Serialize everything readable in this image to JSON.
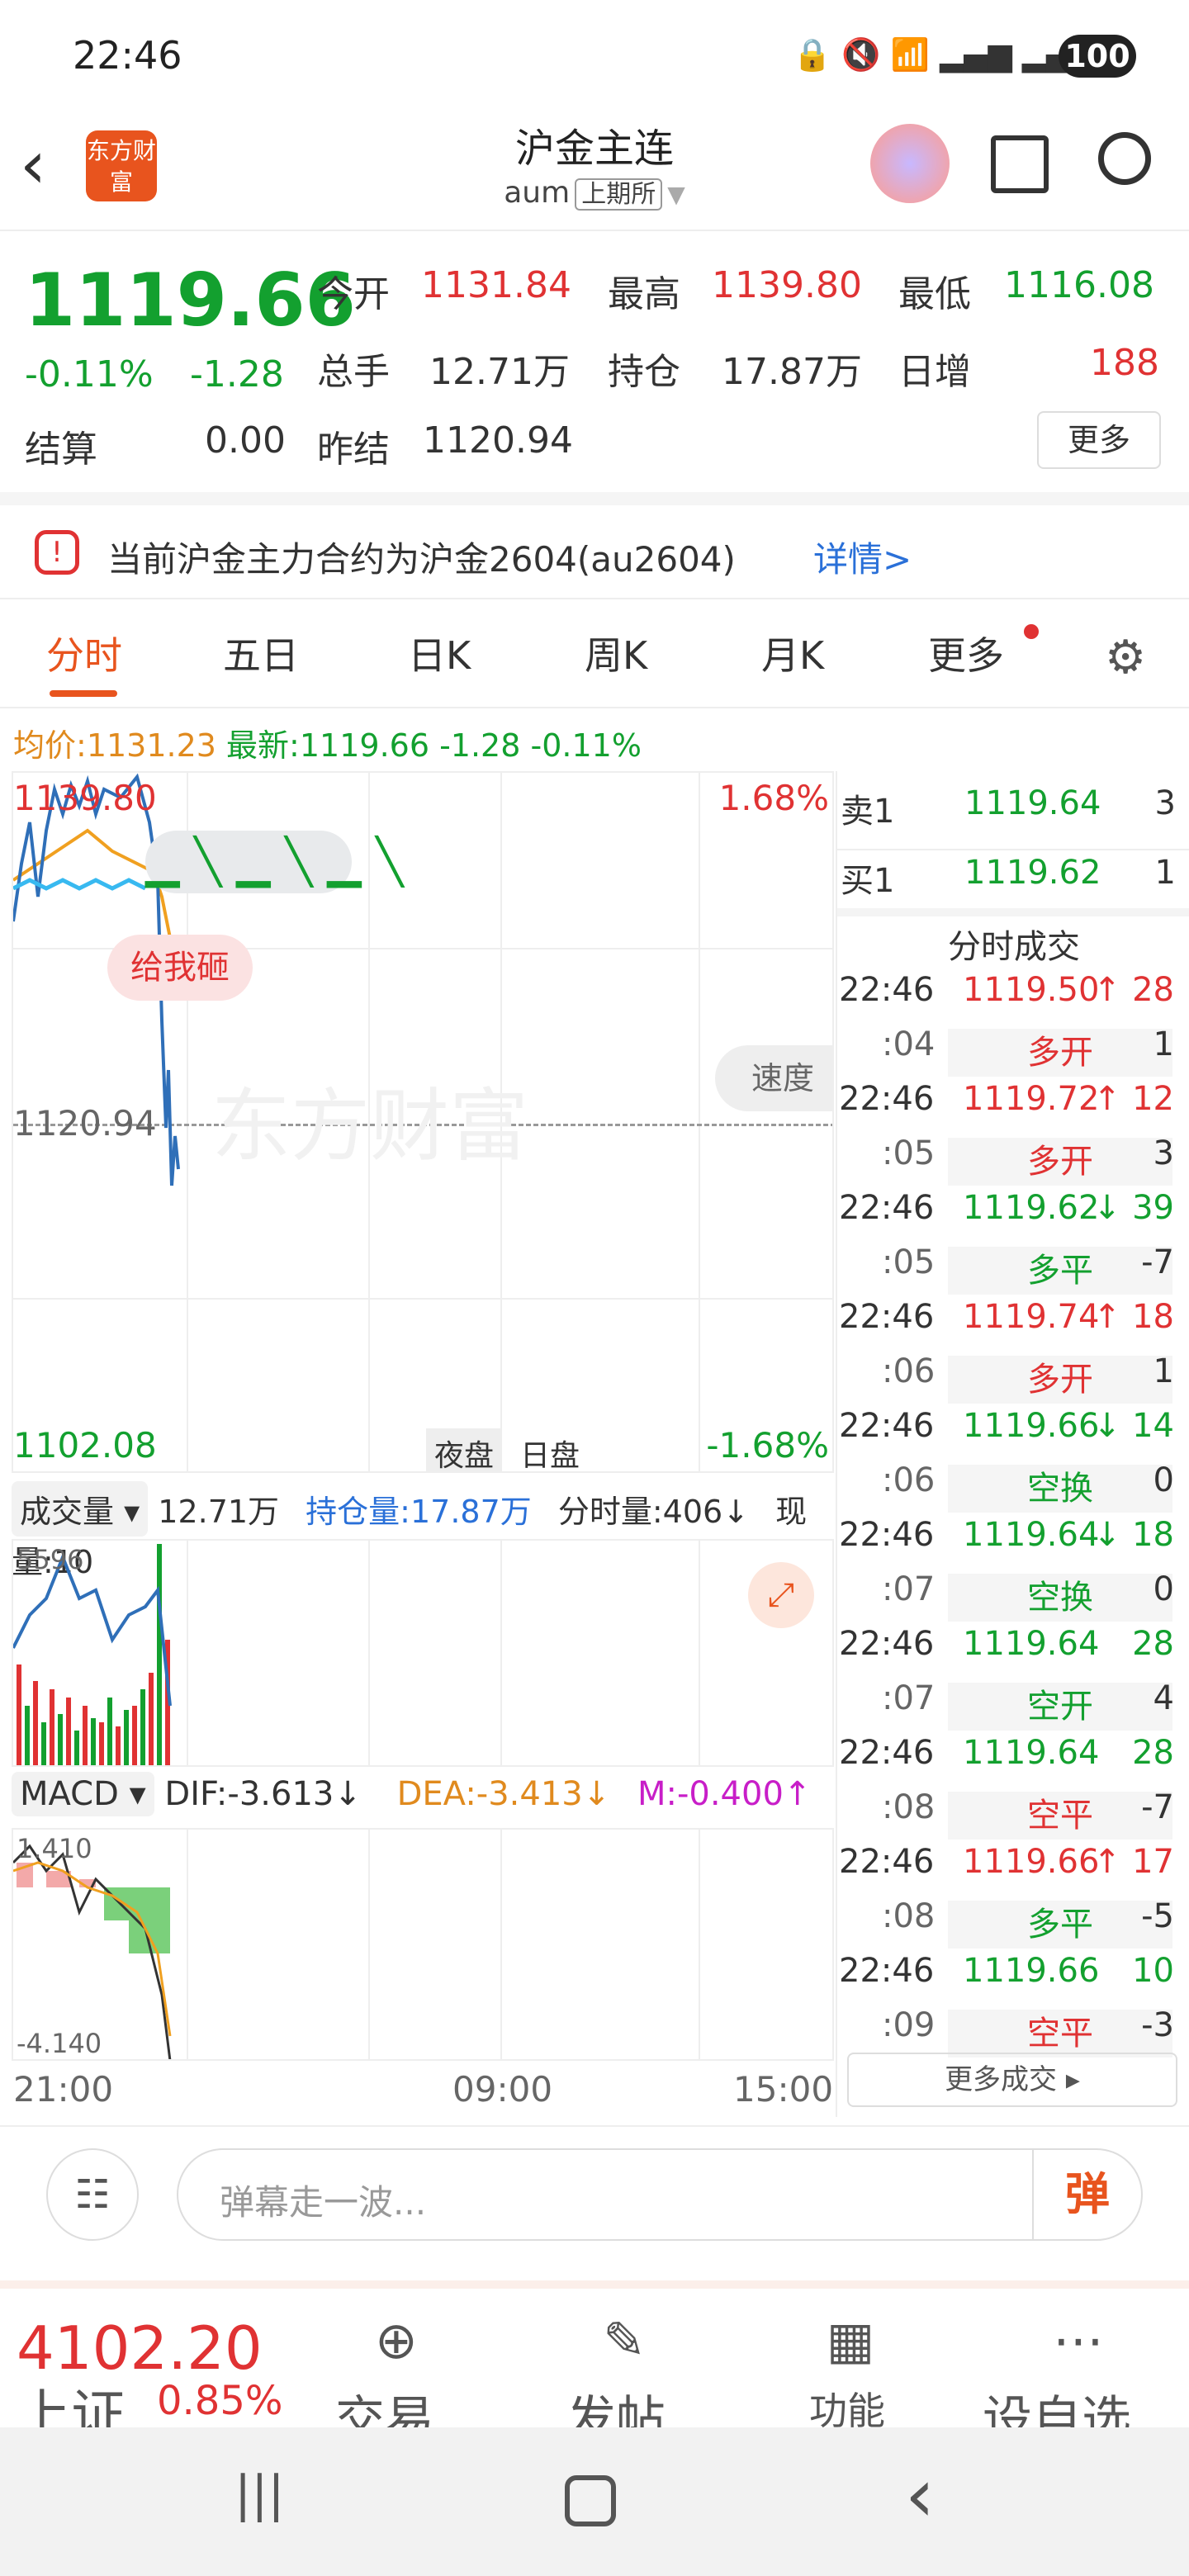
{
  "status": {
    "time": "22:46",
    "battery": "100"
  },
  "header": {
    "logo": "东方财富",
    "title": "沪金主连",
    "code": "aum",
    "exchange": "上期所"
  },
  "quote": {
    "price": "1119.66",
    "change_pct": "-0.11%",
    "change": "-1.28",
    "open_label": "今开",
    "open": "1131.84",
    "high_label": "最高",
    "high": "1139.80",
    "low_label": "最低",
    "low": "1116.08",
    "vol_label": "总手",
    "vol": "12.71万",
    "oi_label": "持仓",
    "oi": "17.87万",
    "daily_inc_label": "日增",
    "daily_inc": "188",
    "settle_label": "结算",
    "settle": "0.00",
    "prev_settle_label": "昨结",
    "prev_settle": "1120.94",
    "more": "更多"
  },
  "notice": {
    "text": "当前沪金主力合约为沪金2604(au2604)",
    "link": "详情>"
  },
  "tabs": [
    "分时",
    "五日",
    "日K",
    "周K",
    "月K",
    "更多"
  ],
  "info": {
    "avg_label": "均价:",
    "avg": "1131.23",
    "latest_label": "最新:",
    "latest": "1119.66",
    "chg": "-1.28",
    "pct": "-0.11%"
  },
  "chart": {
    "top_price": "1139.80",
    "top_pct": "1.68%",
    "mid_price": "1120.94",
    "bottom_price": "1102.08",
    "bottom_pct": "-1.68%",
    "night": "夜盘",
    "day": "日盘",
    "speed": "速度",
    "bubble": "给我砸",
    "watermark": "东方财富"
  },
  "vol_panel": {
    "label": "成交量",
    "vol": "12.71万",
    "oi": "持仓量:17.87万",
    "tick": "分时量:406",
    "cur": "现量:10",
    "max": "5596"
  },
  "macd": {
    "label": "MACD",
    "dif": "DIF:-3.613",
    "dea": "DEA:-3.413",
    "m": "M:-0.400",
    "top": "1.410",
    "bottom": "-4.140"
  },
  "xaxis": [
    "21:00",
    "09:00",
    "15:00"
  ],
  "book": {
    "sell_label": "卖1",
    "sell_price": "1119.64",
    "sell_qty": "3",
    "buy_label": "买1",
    "buy_price": "1119.62",
    "buy_qty": "1",
    "title": "分时成交"
  },
  "trades": [
    {
      "t": "22:46",
      "p": "1119.50",
      "arrow": "↑",
      "v": "28",
      "s": ":04",
      "a": "多开",
      "n": "1"
    },
    {
      "t": "22:46",
      "p": "1119.72",
      "arrow": "↑",
      "v": "12",
      "s": ":05",
      "a": "多开",
      "n": "3"
    },
    {
      "t": "22:46",
      "p": "1119.62",
      "arrow": "↓",
      "v": "39",
      "s": ":05",
      "a": "多平",
      "n": "-7"
    },
    {
      "t": "22:46",
      "p": "1119.74",
      "arrow": "↑",
      "v": "18",
      "s": ":06",
      "a": "多开",
      "n": "1"
    },
    {
      "t": "22:46",
      "p": "1119.66",
      "arrow": "↓",
      "v": "14",
      "s": ":06",
      "a": "空换",
      "n": "0"
    },
    {
      "t": "22:46",
      "p": "1119.64",
      "arrow": "↓",
      "v": "18",
      "s": ":07",
      "a": "空换",
      "n": "0"
    },
    {
      "t": "22:46",
      "p": "1119.64",
      "arrow": "",
      "v": "28",
      "s": ":07",
      "a": "空开",
      "n": "4"
    },
    {
      "t": "22:46",
      "p": "1119.64",
      "arrow": "",
      "v": "28",
      "s": ":08",
      "a": "空平",
      "n": "-7"
    },
    {
      "t": "22:46",
      "p": "1119.66",
      "arrow": "↑",
      "v": "17",
      "s": ":08",
      "a": "多平",
      "n": "-5"
    },
    {
      "t": "22:46",
      "p": "1119.66",
      "arrow": "",
      "v": "10",
      "s": ":09",
      "a": "空平",
      "n": "-3"
    }
  ],
  "more_trades": "更多成交",
  "comment": {
    "placeholder": "弹幕走一波...",
    "btn": "弹"
  },
  "bottom": {
    "index_val": "4102.20",
    "index_name": "上证",
    "index_pct": "0.85%",
    "trade": "交易",
    "post": "发帖",
    "func": "功能",
    "custom": "设自选"
  },
  "colors": {
    "up": "#e03233",
    "down": "#13a02f",
    "accent": "#e8541e"
  }
}
